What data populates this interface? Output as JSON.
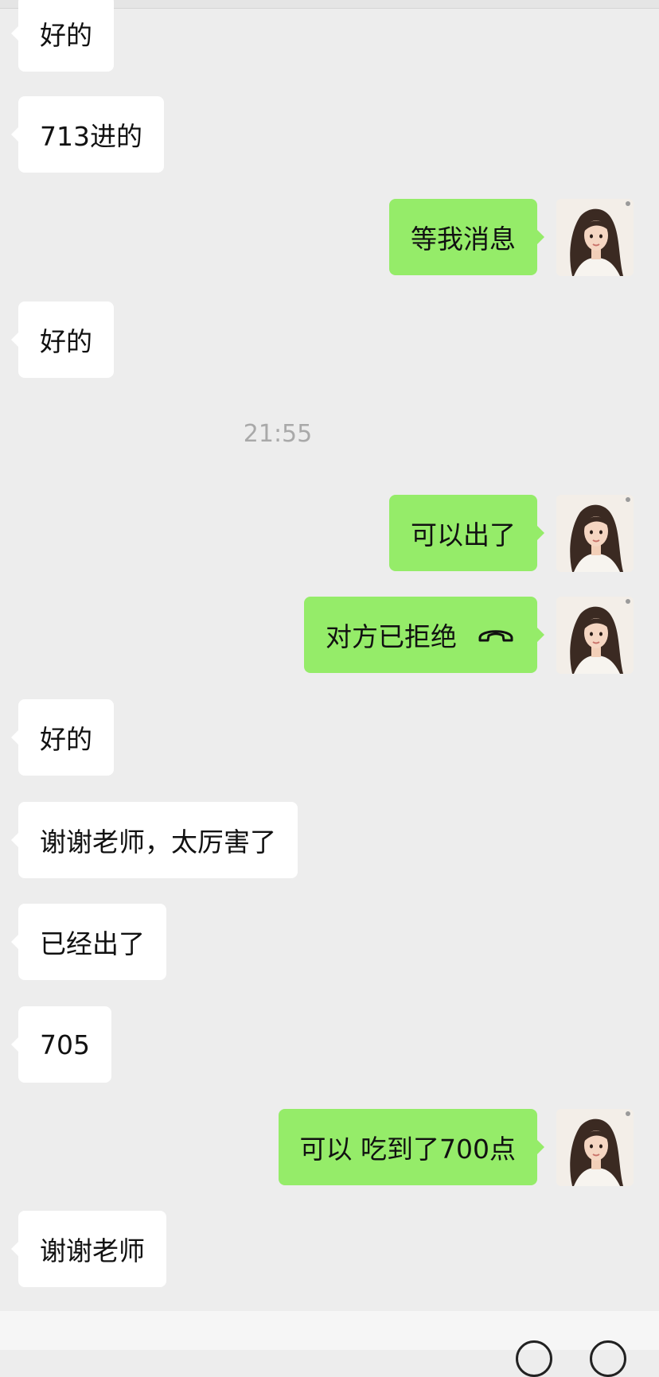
{
  "messages": [
    {
      "side": "left",
      "text": "好的"
    },
    {
      "side": "left",
      "text": "713进的"
    },
    {
      "side": "right",
      "text": "等我消息"
    },
    {
      "side": "left",
      "text": "好的"
    },
    {
      "side": "right",
      "text": "可以出了"
    },
    {
      "side": "right",
      "text": "对方已拒绝",
      "icon": "phone-hangup-icon"
    },
    {
      "side": "left",
      "text": "好的"
    },
    {
      "side": "left",
      "text": "谢谢老师，太厉害了"
    },
    {
      "side": "left",
      "text": "已经出了"
    },
    {
      "side": "left",
      "text": "705"
    },
    {
      "side": "right",
      "text": "可以 吃到了700点"
    },
    {
      "side": "left",
      "text": "谢谢老师"
    }
  ],
  "timestamp": "21:55",
  "colors": {
    "background": "#ededed",
    "self_bubble": "#95ec69",
    "other_bubble": "#ffffff"
  }
}
